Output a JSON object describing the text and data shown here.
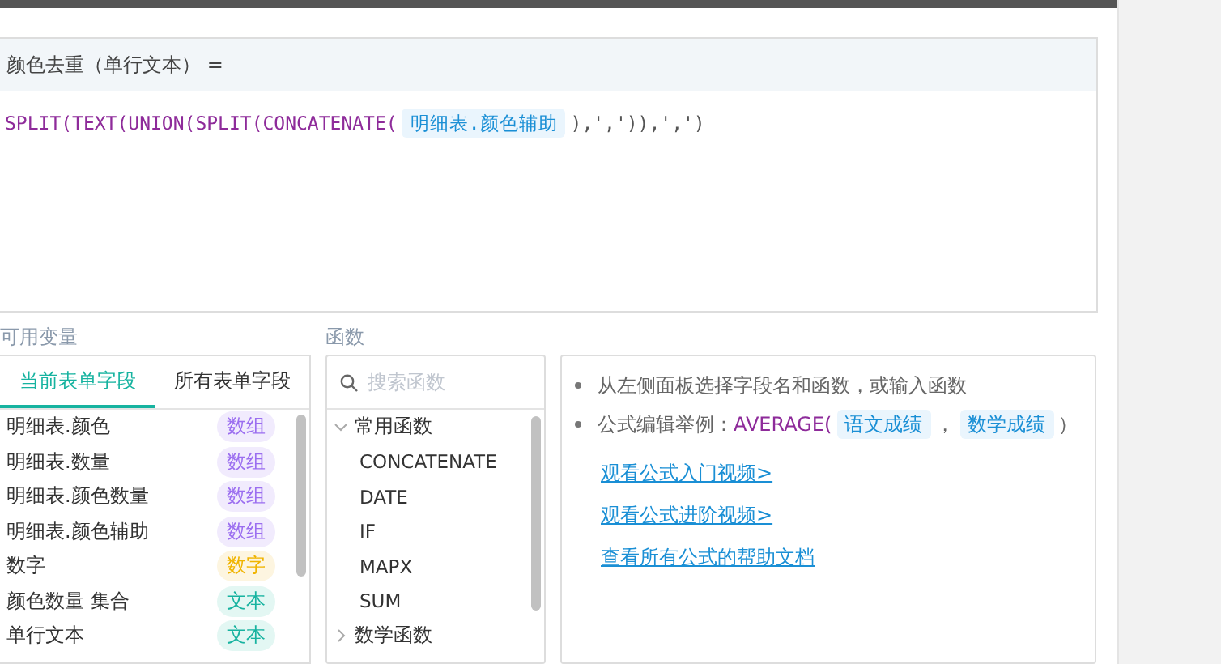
{
  "editor": {
    "title": "颜色去重（单行文本） =",
    "formula": [
      {
        "kind": "func",
        "text": "SPLIT(TEXT(UNION(SPLIT(CONCATENATE("
      },
      {
        "kind": "field",
        "text": "明细表.颜色辅助"
      },
      {
        "kind": "punct",
        "text": "),',')),',')"
      }
    ]
  },
  "variables": {
    "label": "可用变量",
    "tabs": [
      {
        "label": "当前表单字段",
        "selected": true
      },
      {
        "label": "所有表单字段",
        "selected": false
      }
    ],
    "items": [
      {
        "name": "明细表.颜色",
        "type": "数组",
        "kind": "array"
      },
      {
        "name": "明细表.数量",
        "type": "数组",
        "kind": "array"
      },
      {
        "name": "明细表.颜色数量",
        "type": "数组",
        "kind": "array"
      },
      {
        "name": "明细表.颜色辅助",
        "type": "数组",
        "kind": "array"
      },
      {
        "name": "数字",
        "type": "数字",
        "kind": "number"
      },
      {
        "name": "颜色数量 集合",
        "type": "文本",
        "kind": "text"
      },
      {
        "name": "单行文本",
        "type": "文本",
        "kind": "text"
      }
    ]
  },
  "functions": {
    "label": "函数",
    "search": {
      "placeholder": "搜索函数"
    },
    "groups": [
      {
        "label": "常用函数",
        "expanded": true,
        "children": [
          "CONCATENATE",
          "DATE",
          "IF",
          "MAPX",
          "SUM"
        ]
      },
      {
        "label": "数学函数",
        "expanded": false
      }
    ]
  },
  "help": {
    "bullets": [
      [
        {
          "kind": "plain",
          "text": "从左侧面板选择字段名和函数，或输入函数"
        }
      ],
      [
        {
          "kind": "plain",
          "text": "公式编辑举例："
        },
        {
          "kind": "func",
          "text": "AVERAGE("
        },
        {
          "kind": "field",
          "text": "语文成绩"
        },
        {
          "kind": "plain",
          "text": "，"
        },
        {
          "kind": "field",
          "text": "数学成绩"
        },
        {
          "kind": "plain",
          "text": "）"
        }
      ]
    ],
    "links": [
      "观看公式入门视频>",
      "观看公式进阶视频>",
      "查看所有公式的帮助文档"
    ]
  }
}
